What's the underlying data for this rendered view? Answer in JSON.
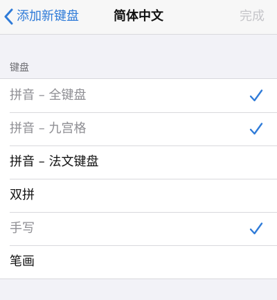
{
  "navbar": {
    "back_label": "添加新键盘",
    "title": "简体中文",
    "done_label": "完成"
  },
  "section": {
    "header": "键盘"
  },
  "keyboards": [
    {
      "label": "拼音 – 全键盘",
      "checked": true,
      "disabled": true
    },
    {
      "label": "拼音 – 九宫格",
      "checked": true,
      "disabled": true
    },
    {
      "label": "拼音 – 法文键盘",
      "checked": false,
      "disabled": false
    },
    {
      "label": "双拼",
      "checked": false,
      "disabled": false
    },
    {
      "label": "手写",
      "checked": true,
      "disabled": true
    },
    {
      "label": "笔画",
      "checked": false,
      "disabled": false
    }
  ],
  "colors": {
    "accent": "#2f7bd8",
    "background": "#f2f2f7",
    "disabled_text": "#8e8e93",
    "done_disabled": "#c5c5c9"
  },
  "icons": {
    "back": "chevron-left-icon",
    "check": "checkmark-icon"
  }
}
